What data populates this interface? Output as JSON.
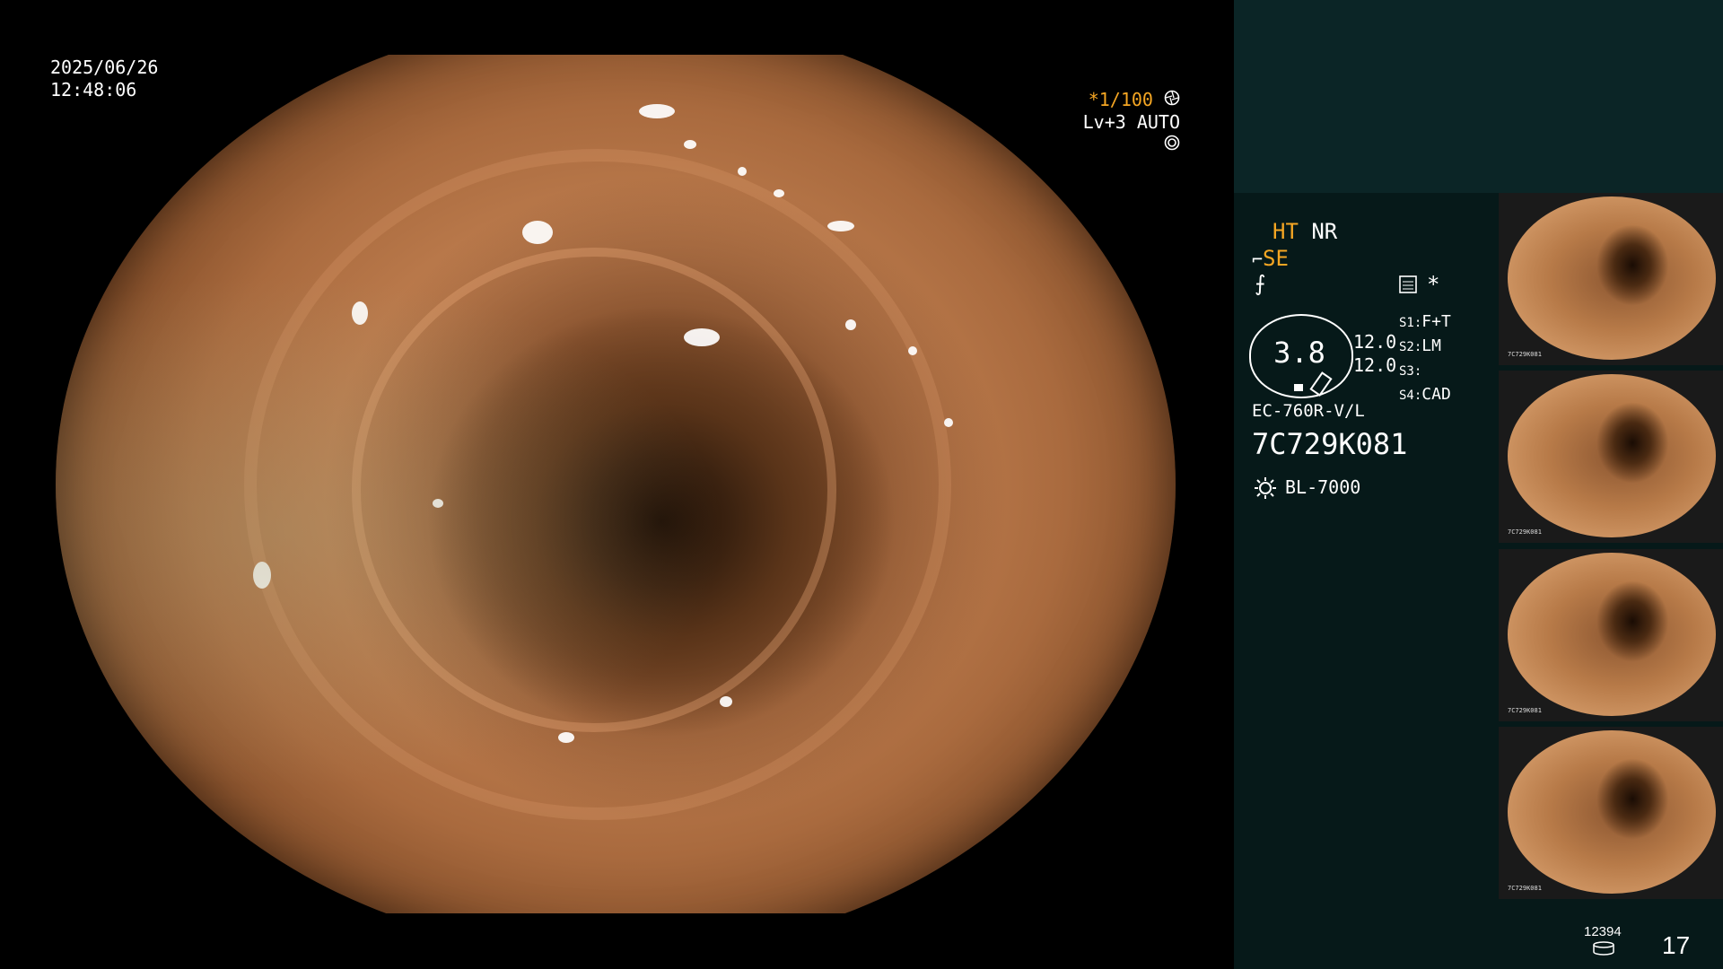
{
  "overlay": {
    "date": "2025/06/26",
    "time": "12:48:06",
    "shutter": "*1/100",
    "level": "Lv+3 AUTO"
  },
  "panel": {
    "ht": "HT",
    "nr": "NR",
    "se": "SE",
    "gauge_value": "3.8",
    "values": [
      "12.0",
      "12.0"
    ],
    "switches": [
      {
        "key": "S1:",
        "value": "F+T"
      },
      {
        "key": "S2:",
        "value": "LM"
      },
      {
        "key": "S3:",
        "value": ""
      },
      {
        "key": "S4:",
        "value": "CAD"
      }
    ],
    "scope_model": "EC-760R-V/L",
    "serial": "7C729K081",
    "light_source": "BL-7000",
    "storage_count": "12394",
    "image_count": "17"
  },
  "thumbnails": [
    {
      "label": "7C729K081"
    },
    {
      "label": "7C729K081"
    },
    {
      "label": "7C729K081"
    },
    {
      "label": "7C729K081"
    }
  ],
  "colors": {
    "accent": "#f5a623",
    "panel_bg": "#061919",
    "panel_top_bg": "#0b2526"
  }
}
